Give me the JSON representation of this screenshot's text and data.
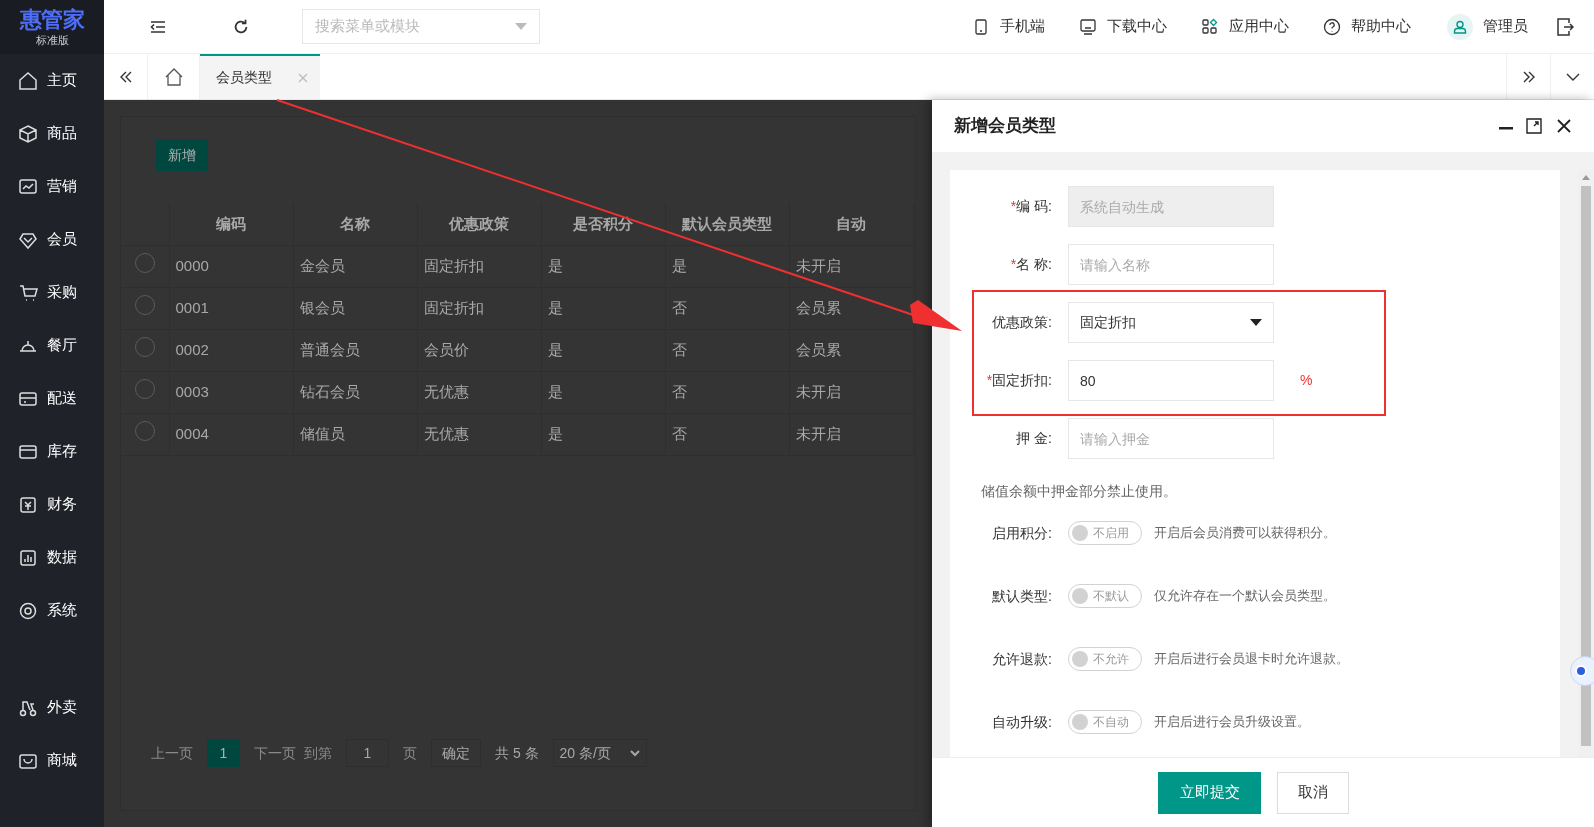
{
  "sidebar": {
    "logo": {
      "title": "惠管家",
      "subtitle": "标准版"
    },
    "items": [
      {
        "label": "主页"
      },
      {
        "label": "商品"
      },
      {
        "label": "营销"
      },
      {
        "label": "会员"
      },
      {
        "label": "采购"
      },
      {
        "label": "餐厅"
      },
      {
        "label": "配送"
      },
      {
        "label": "库存"
      },
      {
        "label": "财务"
      },
      {
        "label": "数据"
      },
      {
        "label": "系统"
      }
    ],
    "extra_items": [
      {
        "label": "外卖"
      },
      {
        "label": "商城"
      }
    ]
  },
  "header": {
    "search": {
      "placeholder": "搜索菜单或模块"
    },
    "links": [
      {
        "label": "手机端"
      },
      {
        "label": "下载中心"
      },
      {
        "label": "应用中心"
      },
      {
        "label": "帮助中心"
      }
    ],
    "user": "管理员"
  },
  "tabs": [
    {
      "label": "会员类型",
      "selected": true
    }
  ],
  "content": {
    "add_button": "新增",
    "table": {
      "columns": [
        "编码",
        "名称",
        "优惠政策",
        "是否积分",
        "默认会员类型",
        "自动"
      ],
      "rows": [
        {
          "selected": false,
          "cells": [
            "0000",
            "金会员",
            "固定折扣",
            "是",
            "是",
            "未开启"
          ]
        },
        {
          "selected": false,
          "cells": [
            "0001",
            "银会员",
            "固定折扣",
            "是",
            "否",
            "会员累"
          ]
        },
        {
          "selected": false,
          "cells": [
            "0002",
            "普通会员",
            "会员价",
            "是",
            "否",
            "会员累"
          ]
        },
        {
          "selected": false,
          "cells": [
            "0003",
            "钻石会员",
            "无优惠",
            "是",
            "否",
            "未开启"
          ]
        },
        {
          "selected": false,
          "cells": [
            "0004",
            "储值员",
            "无优惠",
            "是",
            "否",
            "未开启"
          ]
        }
      ]
    },
    "pagination": {
      "prev": "上一页",
      "current": "1",
      "next": "下一页",
      "goto": "到第",
      "page_input": "1",
      "page_unit": "页",
      "confirm": "确定",
      "total": "共 5 条",
      "page_size": "20 条/页"
    }
  },
  "drawer": {
    "title": "新增会员类型",
    "fields": [
      {
        "kind": "input",
        "required_mark": "*",
        "label": "编 码:",
        "placeholder": "系统自动生成",
        "disabled": true
      },
      {
        "kind": "input",
        "required_mark": "*",
        "label": "名 称:",
        "placeholder": "请输入名称",
        "disabled": false
      },
      {
        "kind": "select",
        "label": "优惠政策:",
        "value": "固定折扣"
      },
      {
        "kind": "input",
        "required_mark": "*",
        "label": "固定折扣:",
        "value": "80",
        "suffix": "%",
        "disabled": false
      },
      {
        "kind": "input",
        "label": "押 金:",
        "placeholder": "请输入押金",
        "disabled": false
      },
      {
        "kind": "note",
        "text": "储值余额中押金部分禁止使用。"
      },
      {
        "kind": "switch",
        "label": "启用积分:",
        "on": false,
        "switch_text": "不启用",
        "hint": "开启后会员消费可以获得积分。"
      },
      {
        "kind": "switch",
        "label": "默认类型:",
        "on": false,
        "switch_text": "不默认",
        "hint": "仅允许存在一个默认会员类型。"
      },
      {
        "kind": "switch",
        "label": "允许退款:",
        "on": false,
        "switch_text": "不允许",
        "hint": "开启后进行会员退卡时允许退款。"
      },
      {
        "kind": "switch",
        "label": "自动升级:",
        "on": false,
        "switch_text": "不自动",
        "hint": "开启后进行会员升级设置。"
      }
    ],
    "submit": "立即提交",
    "cancel": "取消"
  }
}
